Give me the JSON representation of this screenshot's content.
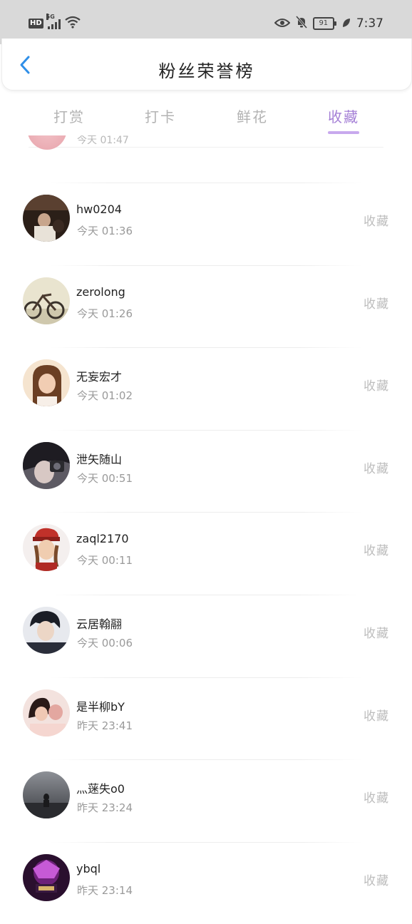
{
  "status_bar": {
    "hd": "HD",
    "network": "5G",
    "battery": "91",
    "time": "7:37"
  },
  "header": {
    "title": "粉丝荣誉榜"
  },
  "tabs": [
    {
      "label": "打赏"
    },
    {
      "label": "打卡"
    },
    {
      "label": "鲜花"
    },
    {
      "label": "收藏"
    }
  ],
  "active_tab": "收藏",
  "accent_color": "#a47fd6",
  "list": [
    {
      "name": "hw0204",
      "time": "今天 01:36",
      "action": "收藏"
    },
    {
      "name": "zerolong",
      "time": "今天 01:26",
      "action": "收藏"
    },
    {
      "name": "无妄宏才",
      "time": "今天 01:02",
      "action": "收藏"
    },
    {
      "name": "泄矢随山",
      "time": "今天 00:51",
      "action": "收藏"
    },
    {
      "name": "zaql2170",
      "time": "今天 00:11",
      "action": "收藏"
    },
    {
      "name": "云居翰翮",
      "time": "今天 00:06",
      "action": "收藏"
    },
    {
      "name": "是半柳bY",
      "time": "昨天 23:41",
      "action": "收藏"
    },
    {
      "name": "灬蒾失o0",
      "time": "昨天 23:24",
      "action": "收藏"
    },
    {
      "name": "ybql",
      "time": "昨天 23:14",
      "action": "收藏"
    }
  ],
  "partial_item": {
    "time": "今天 01:47"
  }
}
